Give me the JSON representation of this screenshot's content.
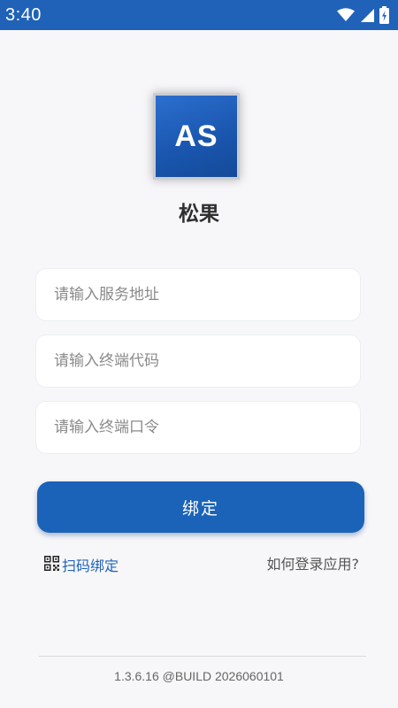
{
  "status_bar": {
    "time": "3:40",
    "icons": [
      "wifi-icon",
      "cellular-signal-icon",
      "battery-charging-icon"
    ]
  },
  "logo": {
    "text": "AS"
  },
  "app": {
    "name": "松果"
  },
  "form": {
    "service_address_placeholder": "请输入服务地址",
    "terminal_code_placeholder": "请输入终端代码",
    "terminal_password_placeholder": "请输入终端口令",
    "bind_button_label": "绑定"
  },
  "links": {
    "scan_bind_label": "扫码绑定",
    "scan_icon": "qr-code-icon",
    "help_label": "如何登录应用?"
  },
  "footer": {
    "version": "1.3.6.16 @BUILD 2026060101"
  },
  "colors": {
    "primary": "#1b63b8",
    "status_bar": "#1f62b8",
    "background": "#f7f7f9"
  }
}
